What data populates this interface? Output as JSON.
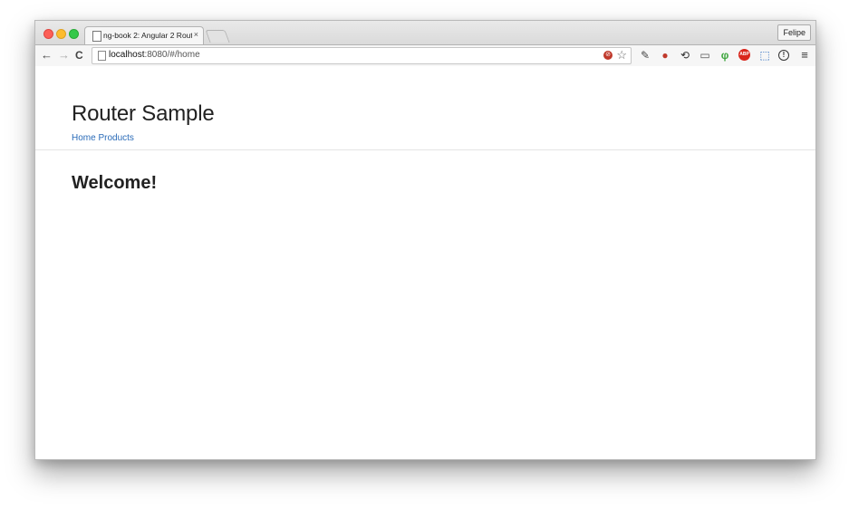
{
  "browser": {
    "tab_title": "ng-book 2: Angular 2 Rout",
    "tab_close": "×",
    "profile_name": "Felipe",
    "url_host": "localhost",
    "url_rest": ":8080/#/home"
  },
  "toolbar_icons": {
    "back": "←",
    "forward": "→",
    "reload": "C",
    "star": "☆",
    "menu": "≡",
    "abp": "ABP",
    "info": "!"
  },
  "page": {
    "title": "Router Sample",
    "nav_home": "Home",
    "nav_products": "Products",
    "welcome": "Welcome!"
  }
}
